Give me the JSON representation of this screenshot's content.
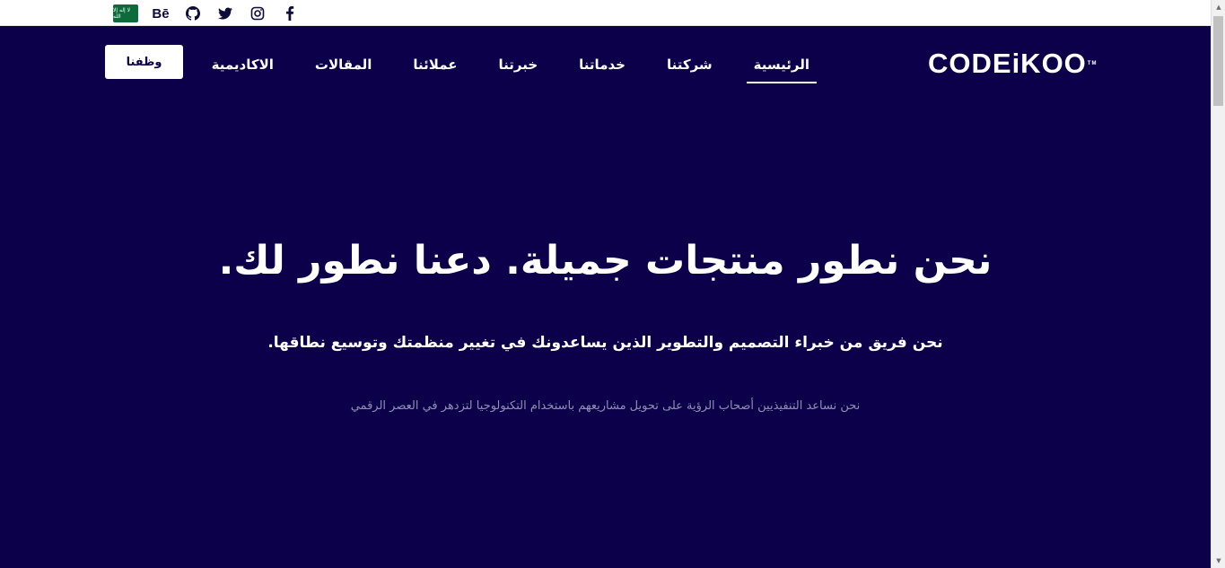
{
  "topbar": {
    "flag_text": "لا إله إلا الله",
    "social": [
      {
        "name": "behance",
        "label": "Bē"
      },
      {
        "name": "github",
        "label": ""
      },
      {
        "name": "twitter",
        "label": ""
      },
      {
        "name": "instagram",
        "label": ""
      },
      {
        "name": "facebook",
        "label": "f"
      }
    ]
  },
  "nav": {
    "cta_label": "وظفنا",
    "items": [
      {
        "label": "الرئيسية",
        "active": true
      },
      {
        "label": "شركتنا",
        "active": false
      },
      {
        "label": "خدماتنا",
        "active": false
      },
      {
        "label": "خبرتنا",
        "active": false
      },
      {
        "label": "عملائنا",
        "active": false
      },
      {
        "label": "المقالات",
        "active": false
      },
      {
        "label": "الاكاديمية",
        "active": false
      }
    ],
    "logo_text": "CODEiKOO",
    "logo_tm": "TM"
  },
  "hero": {
    "headline": "نحن نطور منتجات جميلة. دعنا نطور لك.",
    "subline": "نحن فريق من خبراء التصميم والتطوير الذين يساعدونك في تغيير منظمتك وتوسيع نطاقها.",
    "tagline": "نحن نساعد التنفيذيين أصحاب الرؤية على تحويل مشاريعهم باستخدام التكنولوجيا لتزدهر في العصر الرقمي"
  },
  "colors": {
    "hero_bg": "#0b0049",
    "accent_text": "#ffffff",
    "muted_text": "#8f8fb3"
  }
}
